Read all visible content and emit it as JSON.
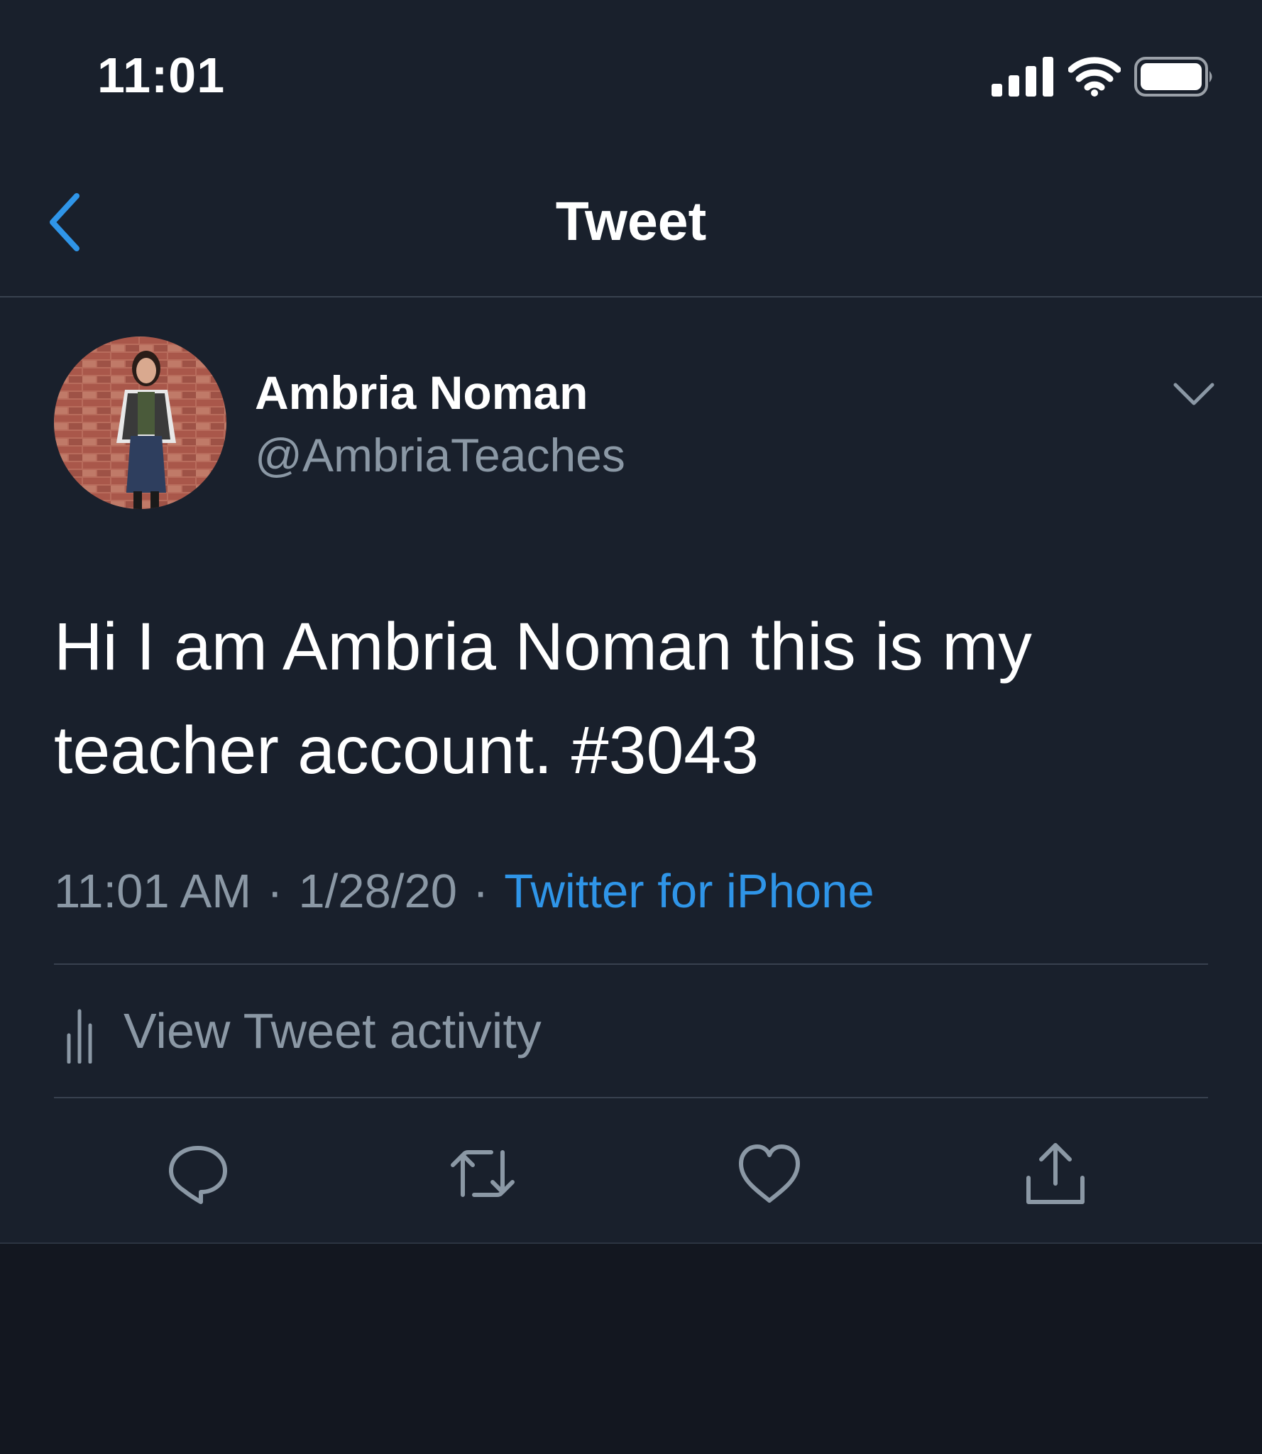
{
  "status_bar": {
    "time": "11:01",
    "icons": [
      "signal-icon",
      "wifi-icon",
      "battery-icon"
    ]
  },
  "header": {
    "back_icon": "chevron-left-icon",
    "title": "Tweet"
  },
  "tweet": {
    "author": {
      "name": "Ambria Noman",
      "handle": "@AmbriaTeaches",
      "avatar": "profile-photo"
    },
    "menu_icon": "chevron-down-icon",
    "text": "Hi I am Ambria Noman this is my teacher account. #3043",
    "time": "11:01 AM",
    "separator": "·",
    "date": "1/28/20",
    "source": "Twitter for iPhone",
    "activity_label": "View Tweet activity",
    "activity_icon": "bar-chart-icon"
  },
  "actions": [
    {
      "icon": "reply-icon"
    },
    {
      "icon": "retweet-icon"
    },
    {
      "icon": "heart-icon"
    },
    {
      "icon": "share-icon"
    }
  ],
  "colors": {
    "background": "#19202c",
    "bottom_background": "#131720",
    "accent": "#2f95e8",
    "secondary_text": "#8b98a5",
    "divider": "#38414f"
  }
}
